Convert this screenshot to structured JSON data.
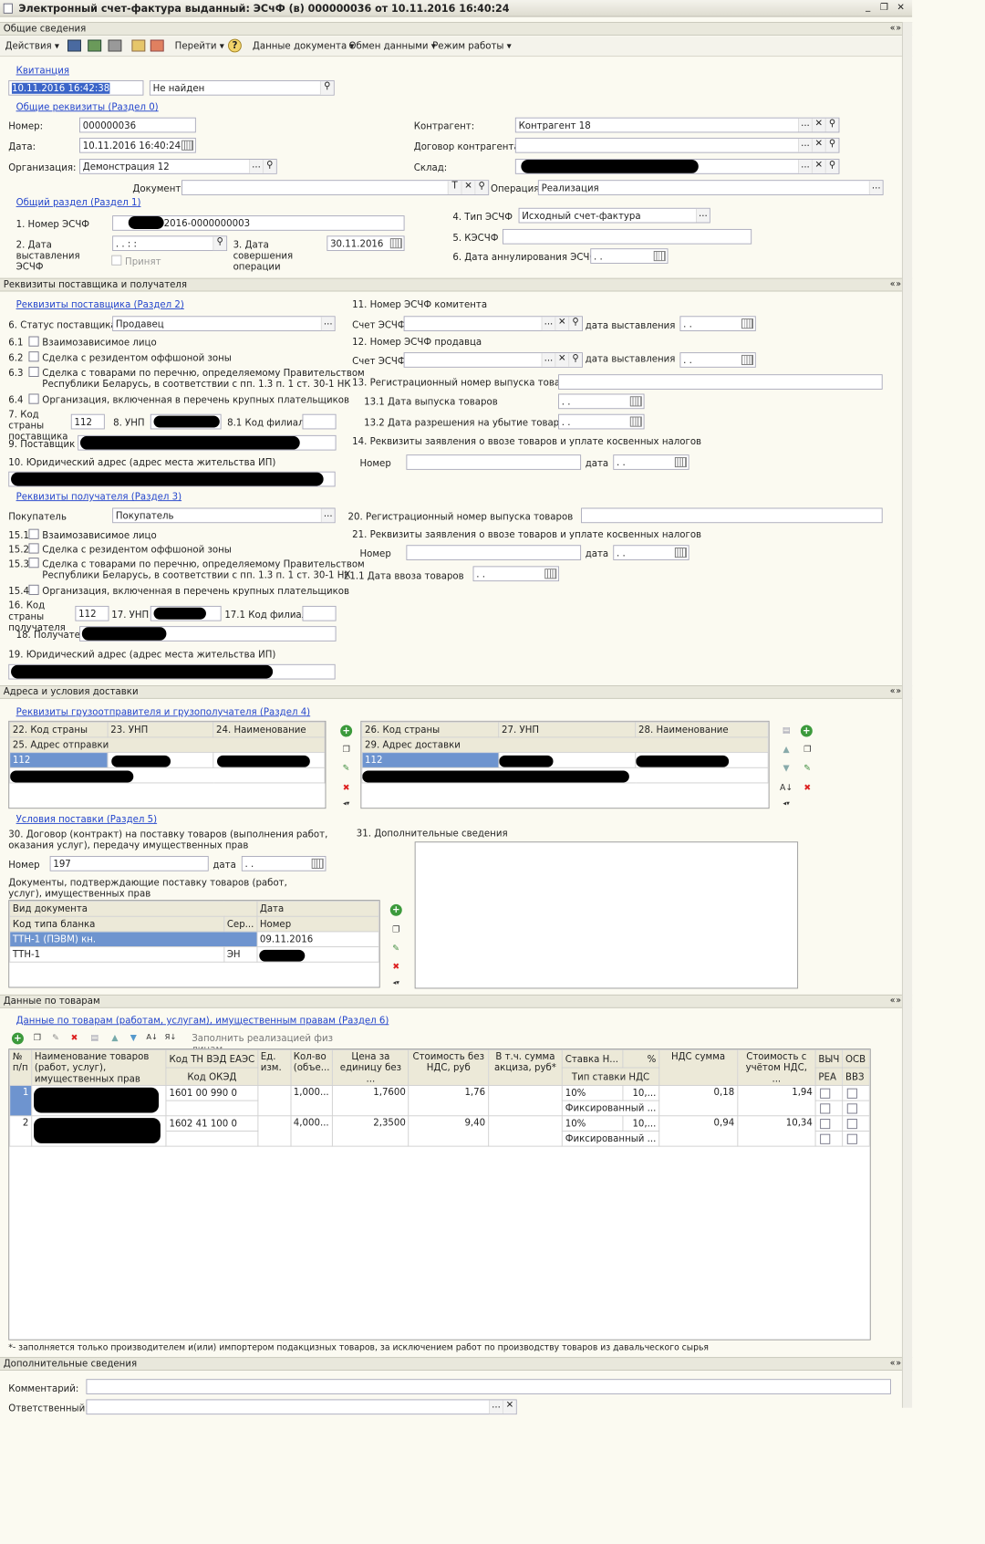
{
  "window": {
    "title": "Электронный счет-фактура выданный: ЭСчФ (в) 000000036 от 10.11.2016 16:40:24",
    "ctrl_min": "_",
    "ctrl_restore": "❐",
    "ctrl_close": "✕"
  },
  "tab": {
    "label": "Общие сведения"
  },
  "toolbar": {
    "actions": "Действия",
    "goto": "Перейти",
    "help": "?",
    "doc_data": "Данные документа",
    "exchange": "Обмен данными",
    "mode": "Режим работы"
  },
  "receipt": {
    "link": "Квитанция",
    "datetime": "10.11.2016 16:42:38",
    "status": "Не найден"
  },
  "general": {
    "link": "Общие реквизиты (Раздел 0)",
    "number_label": "Номер:",
    "number": "000000036",
    "date_label": "Дата:",
    "date": "10.11.2016 16:40:24",
    "org_label": "Организация:",
    "org": "Демонстрация 12",
    "contractor_label": "Контрагент:",
    "contractor": "Контрагент 18",
    "contract_label": "Договор контрагента:",
    "contract": "",
    "warehouse_label": "Склад:",
    "document_label": "Документ:",
    "document": "",
    "operation_label": "Операция",
    "operation": "Реализация"
  },
  "section1": {
    "link": "Общий раздел (Раздел 1)",
    "num_label": "1. Номер ЭСЧФ",
    "num_suffix": "2016-0000000003",
    "issue_label": "2. Дата выставления ЭСЧФ",
    "issue_date": ". .   : :",
    "accepted_label": "Принят",
    "op_label": "3. Дата совершения операции",
    "op_date": "30.11.2016",
    "type_label": "4. Тип ЭСЧФ",
    "type": "Исходный счет-фактура",
    "kesch_label": "5. КЭСЧФ",
    "kesch": "",
    "cancel_label": "6. Дата аннулирования ЭСЧФ",
    "cancel_date": ". ."
  },
  "sec_headers": {
    "parties": "Реквизиты поставщика и получателя",
    "addresses": "Адреса и условия доставки",
    "goods": "Данные по товарам",
    "extra": "Дополнительные сведения"
  },
  "supplier": {
    "link": "Реквизиты поставщика (Раздел 2)",
    "status_label": "6. Статус поставщика",
    "status": "Продавец",
    "c61_num": "6.1",
    "c61": "Взаимозависимое лицо",
    "c62_num": "6.2",
    "c62": "Сделка с резидентом оффшоной зоны",
    "c63_num": "6.3",
    "c63a": "Сделка с товарами по перечню, определяемому Правительством",
    "c63b": "Республики Беларусь, в соответствии с пп. 1.3 п. 1 ст. 30-1 НК",
    "c64_num": "6.4",
    "c64": "Организация, включенная в перечень крупных плательщиков",
    "country_label": "7. Код страны поставщика",
    "country": "112",
    "unp_label": "8. УНП",
    "branch_label": "8.1 Код филиала",
    "name_label": "9. Поставщик",
    "addr_label": "10. Юридический адрес (адрес места жительства ИП)"
  },
  "right2": {
    "commit_label": "11. Номер ЭСЧФ комитента",
    "inv_label": "Счет ЭСЧФ",
    "date_label": "дата выставления",
    "seller_label": "12. Номер ЭСЧФ продавца",
    "reg_label": "13. Регистрационный номер выпуска товаров",
    "rel_label": "13.1 Дата выпуска товаров",
    "loss_label": "13.2 Дата разрешения на убытие товаров",
    "decl_label": "14. Реквизиты заявления о ввозе товаров и уплате косвенных налогов",
    "num_label": "Номер",
    "d_label": "дата",
    "empty_date": ". ."
  },
  "recipient": {
    "link": "Реквизиты получателя (Раздел 3)",
    "buyer_label": "Покупатель",
    "buyer": "Покупатель",
    "c151_num": "15.1",
    "c151": "Взаимозависимое лицо",
    "c152_num": "15.2",
    "c152": "Сделка с резидентом оффшоной зоны",
    "c153_num": "15.3",
    "c153a": "Сделка с товарами по перечню, определяемому Правительством",
    "c153b": "Республики Беларусь, в соответствии с пп. 1.3 п. 1 ст. 30-1 НК",
    "c154_num": "15.4",
    "c154": "Организация, включенная в перечень крупных плательщиков",
    "country_label": "16. Код страны получателя",
    "country": "112",
    "unp_label": "17. УНП",
    "branch_label": "17.1 Код филиала",
    "name_label": "18. Получатель",
    "addr_label": "19. Юридический адрес (адрес места жительства ИП)",
    "reg_label": "20. Регистрационный номер выпуска товаров",
    "decl_label": "21. Реквизиты заявления о ввозе товаров и уплате косвенных налогов",
    "import_label": "21.1 Дата ввоза товаров"
  },
  "shipping": {
    "link": "Реквизиты грузоотправителя и грузополучателя (Раздел 4)",
    "h22": "22. Код страны",
    "h23": "23. УНП",
    "h24": "24. Наименование",
    "h25": "25. Адрес отправки",
    "r_country": "112",
    "h26": "26. Код страны",
    "h27": "27. УНП",
    "h28": "28. Наименование",
    "h29": "29. Адрес доставки",
    "d_country": "112"
  },
  "delivery": {
    "link": "Условия поставки (Раздел 5)",
    "contract_label": "30. Договор (контракт) на поставку товаров (выполнения работ, оказания услуг), передачу имущественных прав",
    "num_label": "Номер",
    "num": "197",
    "date_label": "дата",
    "date": ". .",
    "docs_label": "Документы, подтверждающие поставку товаров (работ, услуг), имущественных прав",
    "extra_label": "31. Дополнительные сведения",
    "col_type": "Вид документа",
    "col_date": "Дата",
    "col_code": "Код типа бланка",
    "col_ser": "Сер...",
    "col_num": "Номер",
    "row1_code": "ТТН-1 (ПЭВМ) кн.",
    "row1_date": "09.11.2016",
    "row2_code": "ТТН-1",
    "row2_ser": "ЭН"
  },
  "goods": {
    "link": "Данные по товарам (работам, услугам), имущественным правам (Раздел 6)",
    "fill_btn": "Заполнить реализацией физ лицам",
    "cols": {
      "n": "№ п/п",
      "name": "Наименование товаров (работ, услуг), имущественных прав",
      "tnved": "Код ТН ВЭД ЕАЭС",
      "okzd": "Код ОКЭД",
      "unit": "Ед. изм.",
      "qty": "Кол-во (объе...",
      "price": "Цена за единицу без ...",
      "cost": "Стоимость без НДС, руб",
      "excise": "В т.ч. сумма акциза, руб*",
      "rate": "Ставка Н...",
      "pct": "%",
      "ratetype": "Тип ставки НДС",
      "vat": "НДС сумма",
      "total": "Стоимость с учётом НДС, ...",
      "vych": "ВЫЧ",
      "rea": "РЕА",
      "osv": "ОСВ",
      "vvz": "ВВЗ"
    },
    "rows": [
      {
        "n": "1",
        "tnved": "1601 00 990 0",
        "qty": "1,000...",
        "price": "1,7600",
        "cost": "1,76",
        "rate": "10%",
        "pct": "10,...",
        "ratetype": "Фиксированный ...",
        "vat": "0,18",
        "total": "1,94"
      },
      {
        "n": "2",
        "tnved": "1602 41 100 0",
        "qty": "4,000...",
        "price": "2,3500",
        "cost": "9,40",
        "rate": "10%",
        "pct": "10,...",
        "ratetype": "Фиксированный ...",
        "vat": "0,94",
        "total": "10,34"
      }
    ],
    "footnote": "*- заполняется только производителем и(или) импортером подакцизных товаров, за исключением работ по производству товаров из давальческого сырья"
  },
  "extra": {
    "comment_label": "Комментарий:",
    "comment": "",
    "resp_label": "Ответственный:",
    "resp": ""
  }
}
